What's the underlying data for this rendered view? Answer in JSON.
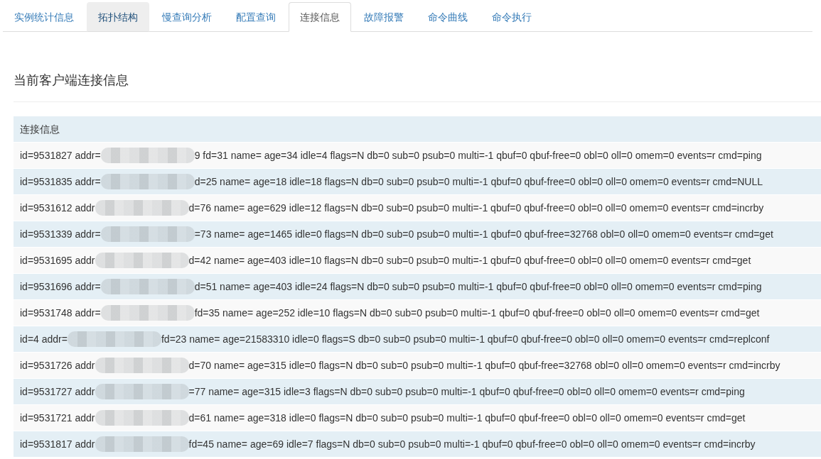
{
  "tabs": [
    {
      "label": "实例统计信息",
      "selected": false,
      "hovered": false
    },
    {
      "label": "拓扑结构",
      "selected": false,
      "hovered": true
    },
    {
      "label": "慢查询分析",
      "selected": false,
      "hovered": false
    },
    {
      "label": "配置查询",
      "selected": false,
      "hovered": false
    },
    {
      "label": "连接信息",
      "selected": true,
      "hovered": false
    },
    {
      "label": "故障报警",
      "selected": false,
      "hovered": false
    },
    {
      "label": "命令曲线",
      "selected": false,
      "hovered": false
    },
    {
      "label": "命令执行",
      "selected": false,
      "hovered": false
    }
  ],
  "section": {
    "title": "当前客户端连接信息"
  },
  "table": {
    "columns": [
      "连接信息"
    ],
    "rows": [
      {
        "segments": [
          {
            "kind": "text",
            "text": "id=9531827 addr="
          },
          {
            "kind": "blurred"
          },
          {
            "kind": "text",
            "text": "9 fd=31 name= age=34 idle=4 flags=N db=0 sub=0 psub=0 multi=-1 qbuf=0 qbuf-free=0 obl=0 oll=0 omem=0 events=r cmd=ping"
          }
        ]
      },
      {
        "segments": [
          {
            "kind": "text",
            "text": "id=9531835 addr="
          },
          {
            "kind": "blurred"
          },
          {
            "kind": "text",
            "text": "d=25 name= age=18 idle=18 flags=N db=0 sub=0 psub=0 multi=-1 qbuf=0 qbuf-free=0 obl=0 oll=0 omem=0 events=r cmd=NULL"
          }
        ]
      },
      {
        "segments": [
          {
            "kind": "text",
            "text": "id=9531612 addr"
          },
          {
            "kind": "blurred"
          },
          {
            "kind": "text",
            "text": "d=76 name= age=629 idle=12 flags=N db=0 sub=0 psub=0 multi=-1 qbuf=0 qbuf-free=0 obl=0 oll=0 omem=0 events=r cmd=incrby"
          }
        ]
      },
      {
        "segments": [
          {
            "kind": "text",
            "text": "id=9531339 addr="
          },
          {
            "kind": "blurred"
          },
          {
            "kind": "text",
            "text": "=73 name= age=1465 idle=0 flags=N db=0 sub=0 psub=0 multi=-1 qbuf=0 qbuf-free=32768 obl=0 oll=0 omem=0 events=r cmd=get"
          }
        ]
      },
      {
        "segments": [
          {
            "kind": "text",
            "text": "id=9531695 addr"
          },
          {
            "kind": "blurred"
          },
          {
            "kind": "text",
            "text": "d=42 name= age=403 idle=10 flags=N db=0 sub=0 psub=0 multi=-1 qbuf=0 qbuf-free=0 obl=0 oll=0 omem=0 events=r cmd=get"
          }
        ]
      },
      {
        "segments": [
          {
            "kind": "text",
            "text": "id=9531696 addr="
          },
          {
            "kind": "blurred"
          },
          {
            "kind": "text",
            "text": "d=51 name= age=403 idle=24 flags=N db=0 sub=0 psub=0 multi=-1 qbuf=0 qbuf-free=0 obl=0 oll=0 omem=0 events=r cmd=ping"
          }
        ]
      },
      {
        "segments": [
          {
            "kind": "text",
            "text": "id=9531748 addr="
          },
          {
            "kind": "blurred"
          },
          {
            "kind": "text",
            "text": "fd=35 name= age=252 idle=10 flags=N db=0 sub=0 psub=0 multi=-1 qbuf=0 qbuf-free=0 obl=0 oll=0 omem=0 events=r cmd=get"
          }
        ]
      },
      {
        "segments": [
          {
            "kind": "text",
            "text": "id=4 addr="
          },
          {
            "kind": "blurred"
          },
          {
            "kind": "text",
            "text": "fd=23 name= age=21583310 idle=0 flags=S db=0 sub=0 psub=0 multi=-1 qbuf=0 qbuf-free=0 obl=0 oll=0 omem=0 events=r cmd=replconf"
          }
        ]
      },
      {
        "segments": [
          {
            "kind": "text",
            "text": "id=9531726 addr"
          },
          {
            "kind": "blurred"
          },
          {
            "kind": "text",
            "text": "d=70 name= age=315 idle=0 flags=N db=0 sub=0 psub=0 multi=-1 qbuf=0 qbuf-free=32768 obl=0 oll=0 omem=0 events=r cmd=incrby"
          }
        ]
      },
      {
        "segments": [
          {
            "kind": "text",
            "text": "id=9531727 addr"
          },
          {
            "kind": "blurred"
          },
          {
            "kind": "text",
            "text": "=77 name= age=315 idle=3 flags=N db=0 sub=0 psub=0 multi=-1 qbuf=0 qbuf-free=0 obl=0 oll=0 omem=0 events=r cmd=ping"
          }
        ]
      },
      {
        "segments": [
          {
            "kind": "text",
            "text": "id=9531721 addr"
          },
          {
            "kind": "blurred"
          },
          {
            "kind": "text",
            "text": "d=61 name= age=318 idle=0 flags=N db=0 sub=0 psub=0 multi=-1 qbuf=0 qbuf-free=0 obl=0 oll=0 omem=0 events=r cmd=get"
          }
        ]
      },
      {
        "segments": [
          {
            "kind": "text",
            "text": "id=9531817 addr"
          },
          {
            "kind": "blurred"
          },
          {
            "kind": "text",
            "text": "fd=45 name= age=69 idle=7 flags=N db=0 sub=0 psub=0 multi=-1 qbuf=0 qbuf-free=0 obl=0 oll=0 omem=0 events=r cmd=incrby"
          }
        ]
      }
    ]
  }
}
